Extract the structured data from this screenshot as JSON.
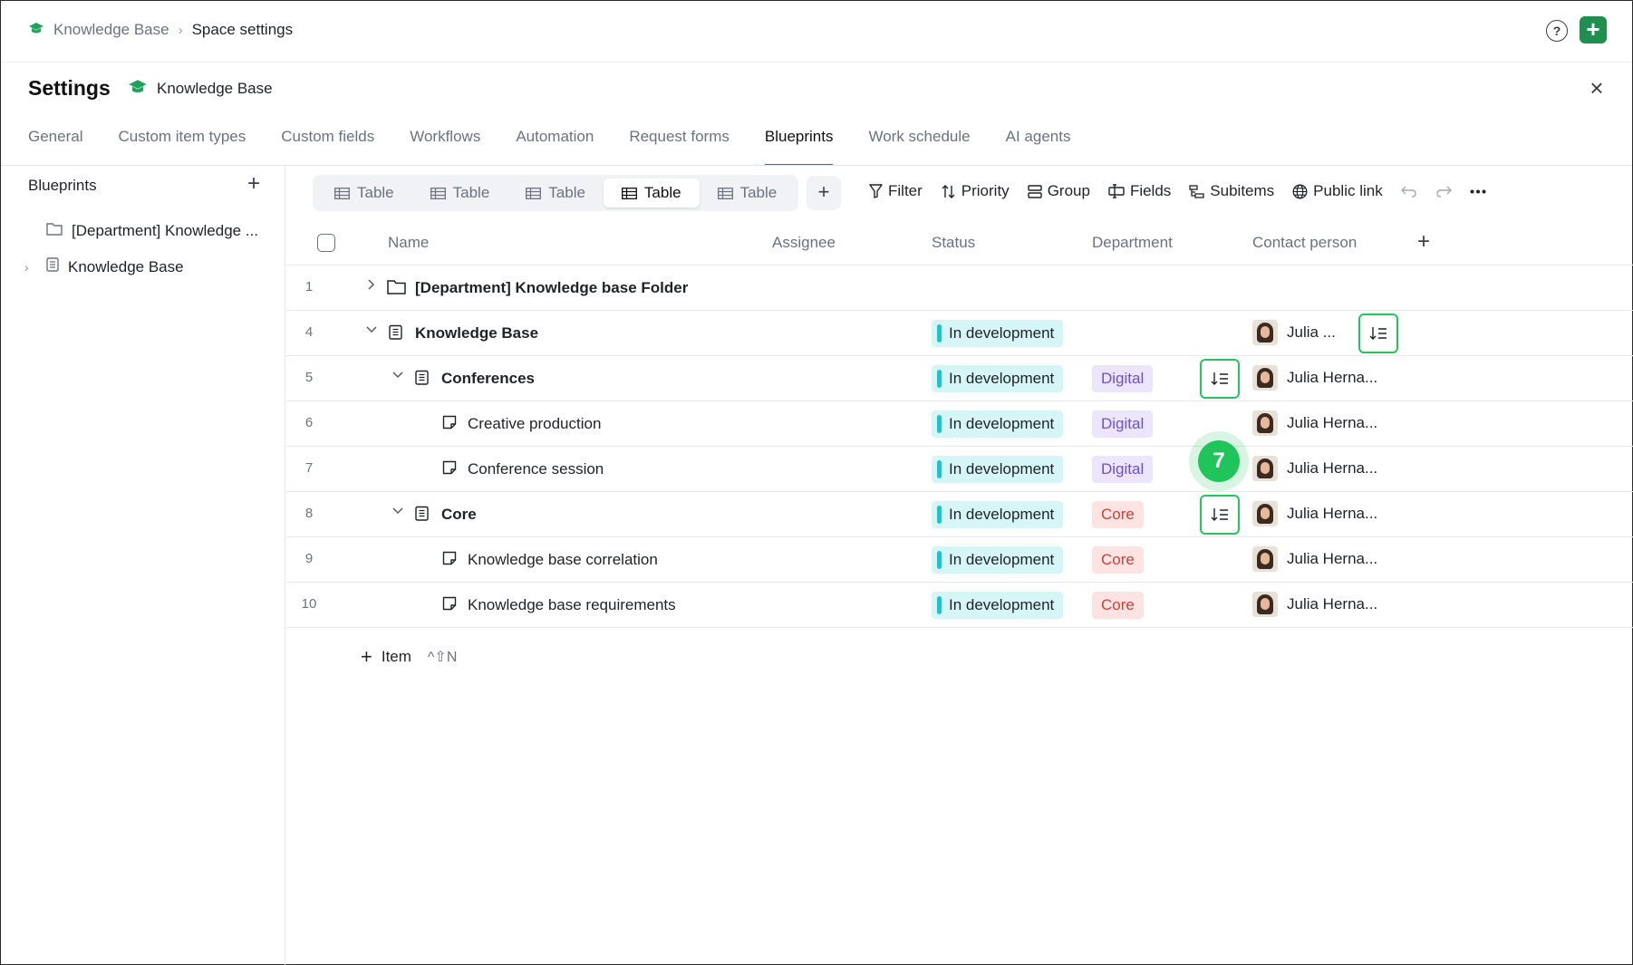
{
  "breadcrumb": {
    "space": "Knowledge Base",
    "current": "Space settings"
  },
  "header": {
    "title": "Settings",
    "space_name": "Knowledge Base"
  },
  "tabs": [
    {
      "label": "General"
    },
    {
      "label": "Custom item types"
    },
    {
      "label": "Custom fields"
    },
    {
      "label": "Workflows"
    },
    {
      "label": "Automation"
    },
    {
      "label": "Request forms"
    },
    {
      "label": "Blueprints",
      "active": true
    },
    {
      "label": "Work schedule"
    },
    {
      "label": "AI agents"
    }
  ],
  "sidebar": {
    "title": "Blueprints",
    "items": [
      {
        "label": "[Department] Knowledge ..."
      },
      {
        "label": "Knowledge Base"
      }
    ]
  },
  "views": [
    {
      "label": "Table"
    },
    {
      "label": "Table"
    },
    {
      "label": "Table"
    },
    {
      "label": "Table",
      "active": true
    },
    {
      "label": "Table"
    }
  ],
  "toolbar": {
    "filter": "Filter",
    "priority": "Priority",
    "group": "Group",
    "fields": "Fields",
    "subitems": "Subitems",
    "public_link": "Public link"
  },
  "columns": {
    "name": "Name",
    "assignee": "Assignee",
    "status": "Status",
    "department": "Department",
    "contact": "Contact person"
  },
  "rows": [
    {
      "num": "1",
      "name": "[Department] Knowledge base Folder"
    },
    {
      "num": "4",
      "name": "Knowledge Base",
      "status": "In development",
      "contact": "Julia ..."
    },
    {
      "num": "5",
      "name": "Conferences",
      "status": "In development",
      "department": "Digital",
      "contact": "Julia Herna..."
    },
    {
      "num": "6",
      "name": "Creative production",
      "status": "In development",
      "department": "Digital",
      "contact": "Julia Herna..."
    },
    {
      "num": "7",
      "name": "Conference session",
      "status": "In development",
      "department": "Digital",
      "contact": "Julia Herna..."
    },
    {
      "num": "8",
      "name": "Core",
      "status": "In development",
      "department": "Core",
      "contact": "Julia Herna..."
    },
    {
      "num": "9",
      "name": "Knowledge base correlation",
      "status": "In development",
      "department": "Core",
      "contact": "Julia Herna..."
    },
    {
      "num": "10",
      "name": "Knowledge base requirements",
      "status": "In development",
      "department": "Core",
      "contact": "Julia Herna..."
    }
  ],
  "add_item": {
    "label": "Item",
    "shortcut": "^⇧N"
  },
  "step_marker": "7",
  "colors": {
    "accent": "#1e8f4e",
    "highlight": "#22c55e",
    "status": "#19c6cf",
    "digital": "#6b52c9",
    "core": "#c9413a"
  }
}
